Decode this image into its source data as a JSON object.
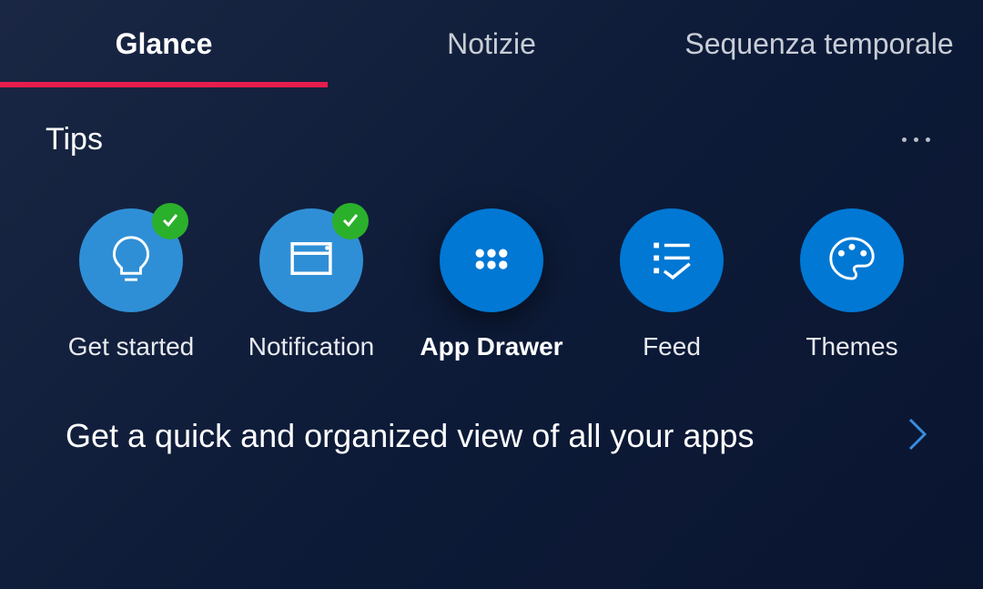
{
  "tabs": [
    {
      "label": "Glance",
      "active": true
    },
    {
      "label": "Notizie",
      "active": false
    },
    {
      "label": "Sequenza temporale",
      "active": false
    }
  ],
  "section": {
    "title": "Tips"
  },
  "tips": [
    {
      "label": "Get started",
      "completed": true,
      "icon": "bulb-icon",
      "light": true
    },
    {
      "label": "Notification",
      "completed": true,
      "icon": "window-icon",
      "light": true
    },
    {
      "label": "App Drawer",
      "completed": false,
      "icon": "apps-icon",
      "selected": true
    },
    {
      "label": "Feed",
      "completed": false,
      "icon": "list-check-icon"
    },
    {
      "label": "Themes",
      "completed": false,
      "icon": "palette-icon"
    }
  ],
  "description": "Get a quick and organized view of all your apps"
}
